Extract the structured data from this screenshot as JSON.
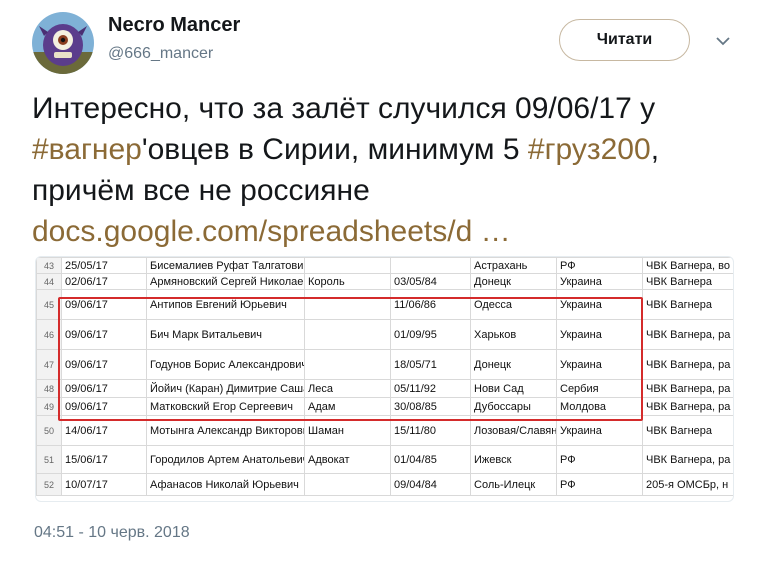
{
  "author": {
    "name": "Necro Mancer",
    "handle": "@666_mancer"
  },
  "follow_label": "Читати",
  "tweet": {
    "part1": "Интересно, что за залёт случился 09/06/17 у ",
    "hashtag1": "#вагнер",
    "part2": "'овцев в Сирии, минимум 5 ",
    "hashtag2": "#груз200",
    "part3": ", причём все не россияне ",
    "link": "docs.google.com/spreadsheets/d  …"
  },
  "spreadsheet": {
    "rows": [
      {
        "num": "43",
        "date": "25/05/17",
        "name": "Бисемалиев Руфат Талгатович",
        "callsign": "",
        "dob": "",
        "city": "Астрахань",
        "country": "РФ",
        "unit": "ЧВК Вагнера, во"
      },
      {
        "num": "44",
        "date": "02/06/17",
        "name": "Армяновский Сергей Николаевич",
        "callsign": "Король",
        "dob": "03/05/84",
        "city": "Донецк",
        "country": "Украина",
        "unit": "ЧВК Вагнера"
      },
      {
        "num": "45",
        "date": "09/06/17",
        "name": "Антипов Евгений Юрьевич",
        "callsign": "",
        "dob": "11/06/86",
        "city": "Одесса",
        "country": "Украина",
        "unit": "ЧВК Вагнера"
      },
      {
        "num": "46",
        "date": "09/06/17",
        "name": "Бич Марк Витальевич",
        "callsign": "",
        "dob": "01/09/95",
        "city": "Харьков",
        "country": "Украина",
        "unit": "ЧВК Вагнера, ра"
      },
      {
        "num": "47",
        "date": "09/06/17",
        "name": "Годунов Борис Александрович",
        "callsign": "",
        "dob": "18/05/71",
        "city": "Донецк",
        "country": "Украина",
        "unit": "ЧВК Вагнера, ра"
      },
      {
        "num": "48",
        "date": "09/06/17",
        "name": "Йойич (Каран) Димитрие Саша",
        "callsign": "Леса",
        "dob": "05/11/92",
        "city": "Нови Сад",
        "country": "Сербия",
        "unit": "ЧВК Вагнера, ра"
      },
      {
        "num": "49",
        "date": "09/06/17",
        "name": "Матковский Егор Сергеевич",
        "callsign": "Адам",
        "dob": "30/08/85",
        "city": "Дубоссары",
        "country": "Молдова",
        "unit": "ЧВК Вагнера, ра"
      },
      {
        "num": "50",
        "date": "14/06/17",
        "name": "Мотынга Александр Викторович",
        "callsign": "Шаман",
        "dob": "15/11/80",
        "city": "Лозовая/Славян",
        "country": "Украина",
        "unit": "ЧВК Вагнера"
      },
      {
        "num": "51",
        "date": "15/06/17",
        "name": "Городилов Артем Анатольевич",
        "callsign": "Адвокат",
        "dob": "01/04/85",
        "city": "Ижевск",
        "country": "РФ",
        "unit": "ЧВК Вагнера, ра"
      },
      {
        "num": "52",
        "date": "10/07/17",
        "name": "Афанасов Николай Юрьевич",
        "callsign": "",
        "dob": "09/04/84",
        "city": "Соль-Илецк",
        "country": "РФ",
        "unit": "205-я ОМСБр, н"
      }
    ]
  },
  "timestamp": "04:51 - 10 черв. 2018",
  "colors": {
    "link": "#8b6a36",
    "highlight_box": "#d42b2b",
    "muted_text": "#657786"
  },
  "icons": {
    "chevron": "chevron-down-icon",
    "avatar": "avatar"
  }
}
